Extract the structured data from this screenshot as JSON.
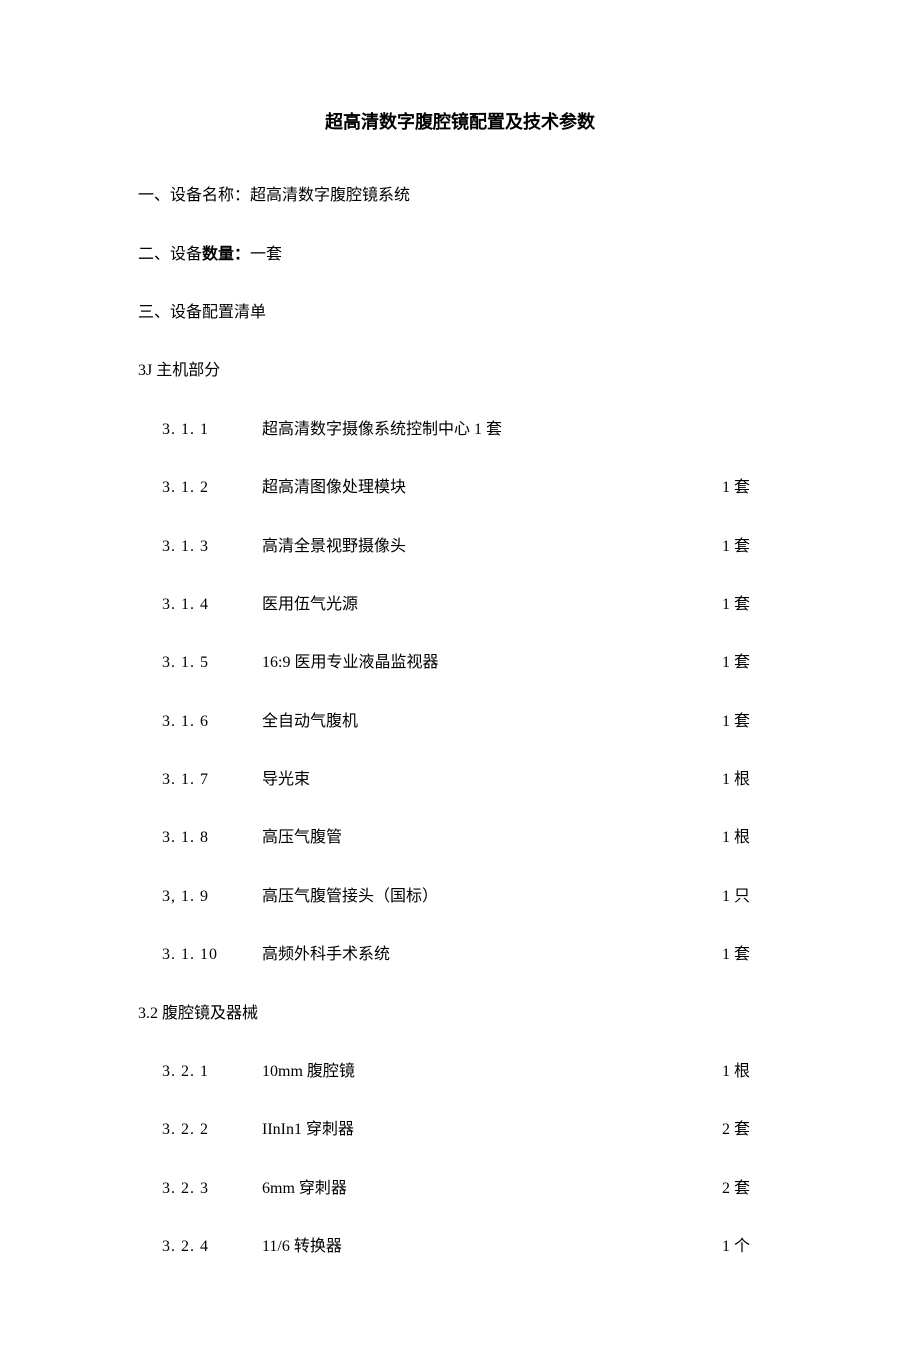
{
  "title": "超高清数字腹腔镜配置及技术参数",
  "section1": {
    "prefix": "一、设备名称：",
    "value": "超高清数字腹腔镜系统"
  },
  "section2": {
    "prefix": "二、设备",
    "boldpart": "数量：",
    "value": "一套"
  },
  "section3": {
    "prefix": "三、设备配置清单"
  },
  "group1": {
    "heading": "3J 主机部分",
    "items": [
      {
        "num": "3. 1. 1",
        "name": "超高清数字摄像系统控制中心 1 套",
        "qty": ""
      },
      {
        "num": "3. 1. 2",
        "name": "超高清图像处理模块",
        "qty": "1 套"
      },
      {
        "num": "3. 1. 3",
        "name": "高清全景视野摄像头",
        "qty": "1 套"
      },
      {
        "num": "3. 1. 4",
        "name": "医用伍气光源",
        "qty": "1 套"
      },
      {
        "num": "3. 1. 5",
        "name": "16:9 医用专业液晶监视器",
        "qty": "1 套"
      },
      {
        "num": "3. 1. 6",
        "name": "全自动气腹机",
        "qty": "1 套"
      },
      {
        "num": "3. 1. 7",
        "name": "导光束",
        "qty": "1 根"
      },
      {
        "num": "3. 1. 8",
        "name": "高压气腹管",
        "qty": "1 根"
      },
      {
        "num": "3, 1. 9",
        "name": "高压气腹管接头（国标）",
        "qty": "1 只"
      },
      {
        "num": "3. 1. 10",
        "name": "高频外科手术系统",
        "qty": "1 套"
      }
    ]
  },
  "group2": {
    "heading": "3.2 腹腔镜及器械",
    "items": [
      {
        "num": "3. 2. 1",
        "name": "10mm 腹腔镜",
        "qty": "1 根"
      },
      {
        "num": "3. 2. 2",
        "name": "IInIn1 穿刺器",
        "qty": "2 套"
      },
      {
        "num": "3. 2. 3",
        "name": "6mm 穿刺器",
        "qty": "2 套"
      },
      {
        "num": "3. 2. 4",
        "name": "11/6 转换器",
        "qty": "1 个"
      }
    ]
  }
}
